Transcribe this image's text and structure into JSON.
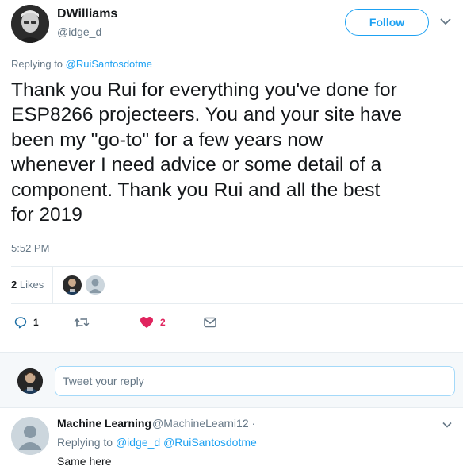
{
  "tweet": {
    "display_name": "DWilliams",
    "handle": "@idge_d",
    "follow_label": "Follow",
    "replying_prefix": "Replying to ",
    "replying_to": "@RuiSantosdotme",
    "text": "Thank you Rui for everything you've done for\nESP8266 projecteers. You and your site have\nbeen my \"go-to\" for a few years now\nwhenever I need advice or some detail of a\ncomponent. Thank you Rui and all the best\nfor 2019",
    "timestamp": "5:52 PM",
    "likes_count": "2",
    "likes_label": "Likes",
    "actions": {
      "reply_count": "1",
      "retweet_count": "",
      "like_count": "2"
    }
  },
  "reply_box": {
    "placeholder": "Tweet your reply"
  },
  "reply": {
    "display_name": "Machine Learning",
    "handle": "@MachineLearni12 ·",
    "replying_prefix": "Replying to ",
    "replying_to_1": "@idge_d",
    "replying_to_2": "@RuiSantosdotme",
    "text": "Same here"
  },
  "colors": {
    "accent": "#1da1f2",
    "secondary_text": "#657786",
    "like_red": "#e0245e",
    "divider": "#e6ecf0"
  },
  "icons": [
    "chevron-down-icon",
    "reply-icon",
    "retweet-icon",
    "heart-icon",
    "envelope-icon",
    "default-avatar-icon"
  ]
}
